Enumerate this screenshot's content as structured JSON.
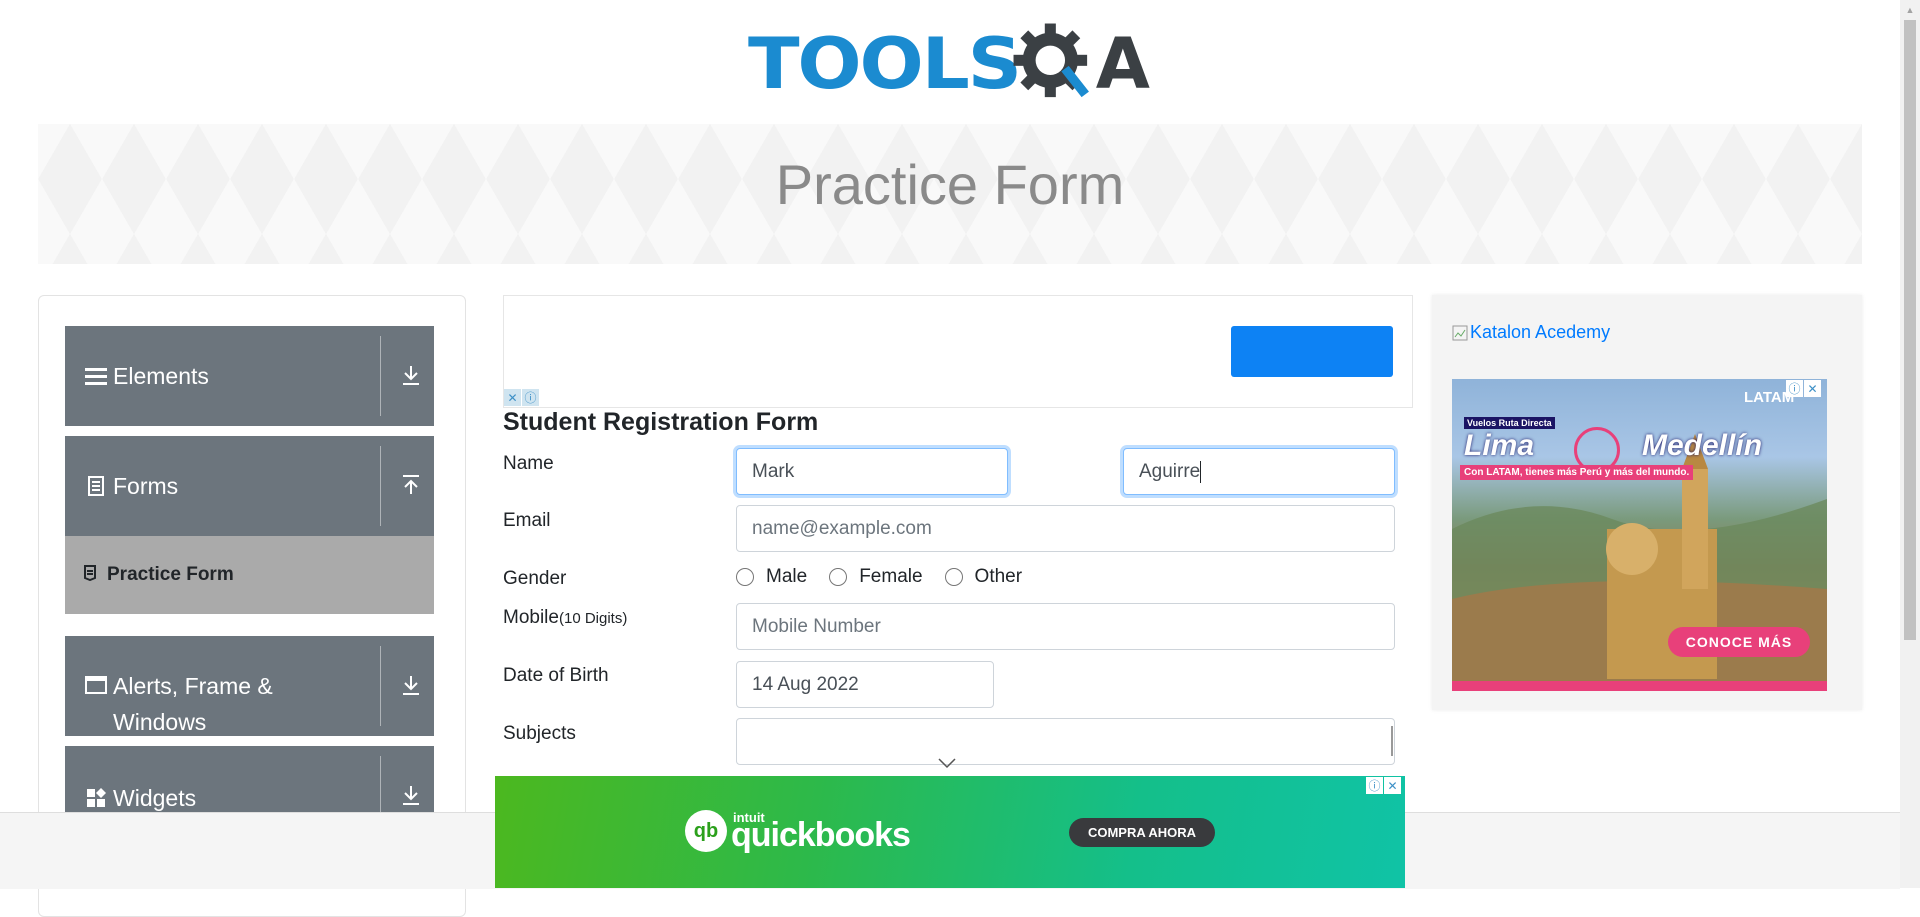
{
  "logo": {
    "text_left": "TOOLS",
    "text_right": "A"
  },
  "banner": {
    "title": "Practice Form"
  },
  "sidebar": {
    "groups": [
      {
        "label": "Elements",
        "icon": "hamburger-icon",
        "expanded": false
      },
      {
        "label": "Forms",
        "icon": "document-icon",
        "expanded": true
      },
      {
        "label": "Alerts, Frame &",
        "label2": "Windows",
        "icon": "window-icon",
        "expanded": false
      },
      {
        "label": "Widgets",
        "icon": "widgets-icon",
        "expanded": false
      }
    ],
    "active_item": {
      "label": "Practice Form",
      "icon": "form-icon"
    }
  },
  "form": {
    "title": "Student Registration Form",
    "name_label": "Name",
    "first_name_value": "Mark",
    "last_name_value": "Aguirre",
    "email_label": "Email",
    "email_placeholder": "name@example.com",
    "gender_label": "Gender",
    "gender_options": [
      "Male",
      "Female",
      "Other"
    ],
    "mobile_label": "Mobile",
    "mobile_hint": "(10 Digits)",
    "mobile_placeholder": "Mobile Number",
    "dob_label": "Date of Birth",
    "dob_value": "14 Aug 2022",
    "subjects_label": "Subjects",
    "subjects_value": ""
  },
  "right_ad": {
    "katalon_alt": "Katalon Acedemy",
    "brand": "LATAM",
    "kicker": "Vuelos Ruta Directa",
    "headline_left": "Lima",
    "headline_right": "Medellín",
    "tagline": "Con LATAM, tienes más Perú y más del mundo.",
    "cta": "CONOCE MÁS"
  },
  "bottom_ad": {
    "brand_small": "intuit",
    "brand": "quickbooks",
    "cta": "COMPRA AHORA"
  },
  "colors": {
    "accent": "#007bff",
    "sidebar_bg": "#6c757d",
    "active_item_bg": "#aaaaaa",
    "logo_blue": "#1b8bd0"
  }
}
